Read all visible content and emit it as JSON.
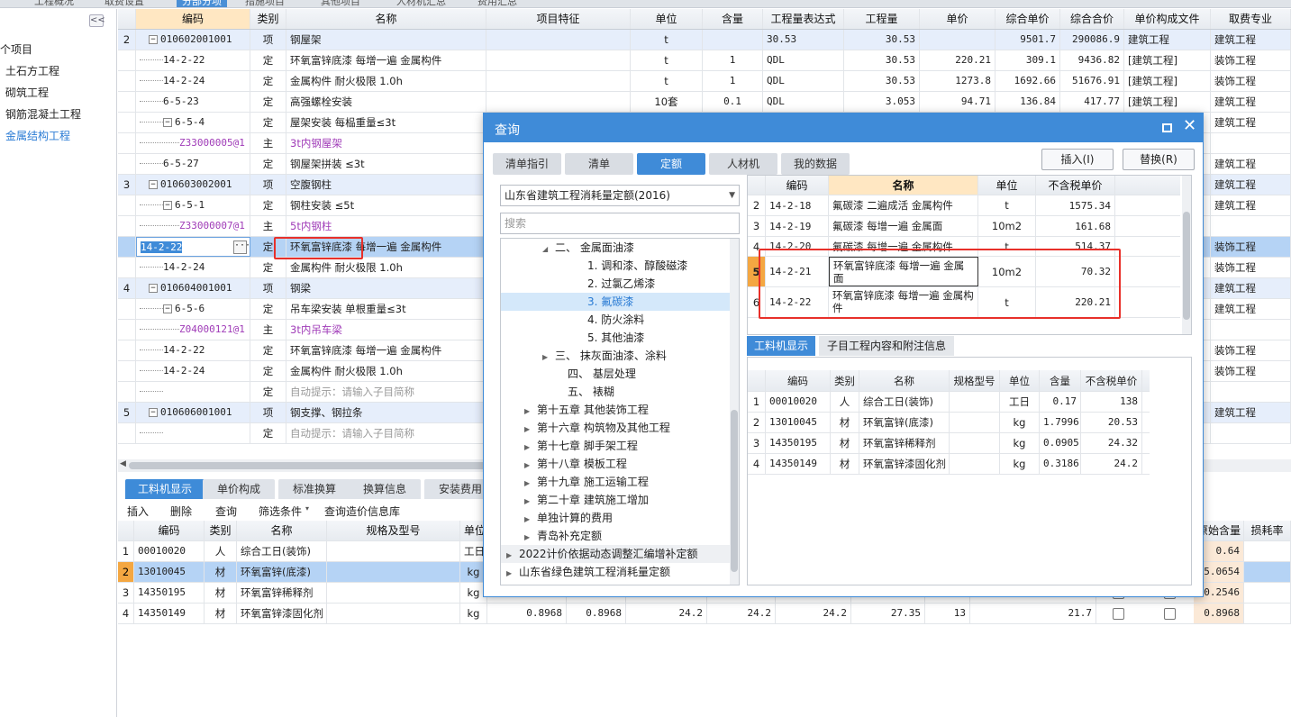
{
  "topbar": {
    "tabs": [
      "工程概况",
      "取费设置",
      "分部分项",
      "措施项目",
      "其他项目",
      "人材机汇总",
      "费用汇总"
    ]
  },
  "left": {
    "collapse": "<<",
    "items": [
      {
        "label": "个项目"
      },
      {
        "label": "土石方工程"
      },
      {
        "label": "砌筑工程"
      },
      {
        "label": "钢筋混凝土工程"
      },
      {
        "label": "金属结构工程",
        "selected": true
      }
    ]
  },
  "main": {
    "headers": [
      "编码",
      "类别",
      "名称",
      "项目特征",
      "单位",
      "含量",
      "工程量表达式",
      "工程量",
      "单价",
      "综合单价",
      "综合合价",
      "单价构成文件",
      "取费专业"
    ],
    "rows": [
      {
        "no": "2",
        "code": "010602001001",
        "type": "项",
        "name": "钢屋架",
        "unit": "t",
        "content": "",
        "expr": "30.53",
        "qty": "30.53",
        "price": "",
        "uprice": "9501.7",
        "total": "290086.9",
        "file": "建筑工程",
        "prof": "建筑工程",
        "kind": "xiang",
        "level": 0,
        "box": "−"
      },
      {
        "code": "14-2-22",
        "type": "定",
        "name": "环氧富锌底漆 每增一遍 金属构件",
        "unit": "t",
        "content": "1",
        "expr": "QDL",
        "qty": "30.53",
        "price": "220.21",
        "uprice": "309.1",
        "total": "9436.82",
        "file": "[建筑工程]",
        "prof": "装饰工程",
        "level": 1
      },
      {
        "code": "14-2-24",
        "type": "定",
        "name": "金属构件 耐火极限 1.0h",
        "unit": "t",
        "content": "1",
        "expr": "QDL",
        "qty": "30.53",
        "price": "1273.8",
        "uprice": "1692.66",
        "total": "51676.91",
        "file": "[建筑工程]",
        "prof": "装饰工程",
        "level": 1
      },
      {
        "code": "6-5-23",
        "type": "定",
        "name": "高强螺栓安装",
        "unit": "10套",
        "content": "0.1",
        "expr": "QDL",
        "qty": "3.053",
        "price": "94.71",
        "uprice": "136.84",
        "total": "417.77",
        "file": "[建筑工程]",
        "prof": "建筑工程",
        "level": 1
      },
      {
        "code": "6-5-4",
        "type": "定",
        "name": "屋架安装 每榀重量≤3t",
        "unit": "",
        "content": "",
        "expr": "",
        "qty": "",
        "price": "",
        "uprice": "",
        "total": "",
        "file": "",
        "prof": "建筑工程",
        "level": 1,
        "box": "−"
      },
      {
        "code": "Z33000005@1",
        "type": "主",
        "name": "3t内钢屋架",
        "unit": "",
        "content": "",
        "expr": "",
        "qty": "",
        "price": "",
        "uprice": "",
        "total": "",
        "file": "",
        "prof": "",
        "level": 2,
        "purple": true
      },
      {
        "code": "6-5-27",
        "type": "定",
        "name": "钢屋架拼装 ≤3t",
        "unit": "",
        "content": "",
        "expr": "",
        "qty": "",
        "price": "",
        "uprice": "",
        "total": "",
        "file": "",
        "prof": "建筑工程",
        "level": 1
      },
      {
        "no": "3",
        "code": "010603002001",
        "type": "项",
        "name": "空腹钢柱",
        "unit": "",
        "content": "",
        "expr": "",
        "qty": "",
        "price": "",
        "uprice": "",
        "total": "",
        "file": "",
        "prof": "建筑工程",
        "kind": "xiang",
        "level": 0,
        "box": "−"
      },
      {
        "code": "6-5-1",
        "type": "定",
        "name": "钢柱安装 ≤5t",
        "unit": "",
        "content": "",
        "expr": "",
        "qty": "",
        "price": "",
        "uprice": "",
        "total": "",
        "file": "",
        "prof": "建筑工程",
        "level": 1,
        "box": "−"
      },
      {
        "code": "Z33000007@1",
        "type": "主",
        "name": "5t内钢柱",
        "unit": "",
        "content": "",
        "expr": "",
        "qty": "",
        "price": "",
        "uprice": "",
        "total": "",
        "file": "",
        "prof": "",
        "level": 2,
        "purple": true
      },
      {
        "code": "14-2-22",
        "type": "定",
        "name": "环氧富锌底漆 每增一遍 金属构件",
        "unit": "",
        "content": "",
        "expr": "",
        "qty": "",
        "price": "",
        "uprice": "",
        "total": "",
        "file": "",
        "prof": "装饰工程",
        "kind": "sel",
        "editing": true
      },
      {
        "code": "14-2-24",
        "type": "定",
        "name": "金属构件 耐火极限 1.0h",
        "unit": "",
        "content": "",
        "expr": "",
        "qty": "",
        "price": "",
        "uprice": "",
        "total": "",
        "file": "",
        "prof": "装饰工程",
        "level": 1
      },
      {
        "no": "4",
        "code": "010604001001",
        "type": "项",
        "name": "钢梁",
        "unit": "",
        "content": "",
        "expr": "",
        "qty": "",
        "price": "",
        "uprice": "",
        "total": "",
        "file": "",
        "prof": "建筑工程",
        "kind": "xiang",
        "level": 0,
        "box": "−"
      },
      {
        "code": "6-5-6",
        "type": "定",
        "name": "吊车梁安装 单根重量≤3t",
        "unit": "",
        "content": "",
        "expr": "",
        "qty": "",
        "price": "",
        "uprice": "",
        "total": "",
        "file": "",
        "prof": "建筑工程",
        "level": 1,
        "box": "−"
      },
      {
        "code": "Z04000121@1",
        "type": "主",
        "name": "3t内吊车梁",
        "unit": "",
        "content": "",
        "expr": "",
        "qty": "",
        "price": "",
        "uprice": "",
        "total": "",
        "file": "",
        "prof": "",
        "level": 2,
        "purple": true
      },
      {
        "code": "14-2-22",
        "type": "定",
        "name": "环氧富锌底漆 每增一遍 金属构件",
        "unit": "",
        "content": "",
        "expr": "",
        "qty": "",
        "price": "",
        "uprice": "",
        "total": "",
        "file": "",
        "prof": "装饰工程",
        "level": 1
      },
      {
        "code": "14-2-24",
        "type": "定",
        "name": "金属构件 耐火极限 1.0h",
        "unit": "",
        "content": "",
        "expr": "",
        "qty": "",
        "price": "",
        "uprice": "",
        "total": "",
        "file": "",
        "prof": "装饰工程",
        "level": 1
      },
      {
        "code": "",
        "type": "定",
        "name": "自动提示：请输入子目简称",
        "unit": "",
        "content": "",
        "expr": "",
        "qty": "",
        "price": "",
        "uprice": "",
        "total": "",
        "file": "",
        "prof": "",
        "level": 1,
        "gray": true
      },
      {
        "no": "5",
        "code": "010606001001",
        "type": "项",
        "name": "钢支撑、钢拉条",
        "unit": "",
        "content": "",
        "expr": "",
        "qty": "",
        "price": "",
        "uprice": "",
        "total": "",
        "file": "",
        "prof": "建筑工程",
        "kind": "xiang",
        "level": 0,
        "box": "−"
      },
      {
        "code": "",
        "type": "定",
        "name": "自动提示：请输入子目简称",
        "unit": "",
        "content": "",
        "expr": "",
        "qty": "",
        "price": "",
        "uprice": "",
        "total": "",
        "file": "",
        "prof": "",
        "level": 1,
        "gray": true
      }
    ]
  },
  "bottom": {
    "tabs": [
      "工料机显示",
      "单价构成",
      "标准换算",
      "换算信息",
      "安装费用"
    ],
    "toolbar": [
      "插入",
      "删除",
      "查询",
      "筛选条件",
      "查询造价信息库"
    ],
    "headers": [
      "编码",
      "类别",
      "名称",
      "规格及型号",
      "单位",
      "原始含量",
      "损耗率"
    ],
    "rows": [
      {
        "no": "1",
        "code": "00010020",
        "type": "人",
        "name": "综合工日(装饰)",
        "unit": "工日",
        "orig": "0.64"
      },
      {
        "no": "2",
        "code": "13010045",
        "type": "材",
        "name": "环氧富锌(底漆)",
        "unit": "kg",
        "orig": "5.0654",
        "sel": true
      },
      {
        "no": "3",
        "code": "14350195",
        "type": "材",
        "name": "环氧富锌稀释剂",
        "unit": "kg",
        "orig": "0.2546"
      },
      {
        "no": "4",
        "code": "14350149",
        "type": "材",
        "name": "环氧富锌漆固化剂",
        "unit": "kg",
        "v1": "0.8968",
        "v2": "0.8968",
        "v3": "24.2",
        "v4": "24.2",
        "v5": "24.2",
        "v6": "27.35",
        "v7": "13",
        "v8": "21.7",
        "orig": "0.8968"
      }
    ]
  },
  "dialog": {
    "title": "查询",
    "tabs": [
      "清单指引",
      "清单",
      "定额",
      "人材机",
      "我的数据"
    ],
    "insert": "插入(I)",
    "replace": "替换(R)",
    "library": "山东省建筑工程消耗量定额(2016)",
    "search_placeholder": "搜索",
    "tree": [
      {
        "label": "二、 金属面油漆",
        "indent": 46,
        "arrow": "◢"
      },
      {
        "label": "1. 调和漆、醇酸磁漆",
        "indent": 82
      },
      {
        "label": "2. 过氯乙烯漆",
        "indent": 82
      },
      {
        "label": "3. 氟碳漆",
        "indent": 82,
        "sel": true
      },
      {
        "label": "4. 防火涂料",
        "indent": 82
      },
      {
        "label": "5. 其他油漆",
        "indent": 82
      },
      {
        "label": "三、 抹灰面油漆、涂料",
        "indent": 46,
        "arrow": "▶"
      },
      {
        "label": "四、 基层处理",
        "indent": 60
      },
      {
        "label": "五、 裱糊",
        "indent": 60
      },
      {
        "label": "第十五章 其他装饰工程",
        "indent": 26,
        "arrow": "▶"
      },
      {
        "label": "第十六章 构筑物及其他工程",
        "indent": 26,
        "arrow": "▶"
      },
      {
        "label": "第十七章 脚手架工程",
        "indent": 26,
        "arrow": "▶"
      },
      {
        "label": "第十八章 模板工程",
        "indent": 26,
        "arrow": "▶"
      },
      {
        "label": "第十九章 施工运输工程",
        "indent": 26,
        "arrow": "▶"
      },
      {
        "label": "第二十章 建筑施工增加",
        "indent": 26,
        "arrow": "▶"
      },
      {
        "label": "单独计算的费用",
        "indent": 26,
        "arrow": "▶"
      },
      {
        "label": "青岛补充定额",
        "indent": 26,
        "arrow": "▶"
      },
      {
        "label": "2022计价依据动态调整汇编增补定额",
        "indent": 6,
        "arrow": "▶",
        "hl": true
      },
      {
        "label": "山东省绿色建筑工程消耗量定额",
        "indent": 6,
        "arrow": "▶"
      }
    ],
    "quota_headers": [
      "编码",
      "名称",
      "单位",
      "不含税单价"
    ],
    "quota_rows": [
      {
        "no": "2",
        "code": "14-2-18",
        "name": "氟碳漆 二遍成活 金属构件",
        "unit": "t",
        "price": "1575.34"
      },
      {
        "no": "3",
        "code": "14-2-19",
        "name": "氟碳漆 每增一遍 金属面",
        "unit": "10m2",
        "price": "161.68"
      },
      {
        "no": "4",
        "code": "14-2-20",
        "name": "氟碳漆 每增一遍 金属构件",
        "unit": "t",
        "price": "514.37"
      },
      {
        "no": "5",
        "code": "14-2-21",
        "name": "环氧富锌底漆 每增一遍 金属面",
        "unit": "10m2",
        "price": "70.32",
        "sel": true
      },
      {
        "no": "6",
        "code": "14-2-22",
        "name": "环氧富锌底漆 每增一遍 金属构件",
        "unit": "t",
        "price": "220.21"
      }
    ],
    "sub_tabs": [
      "工料机显示",
      "子目工程内容和附注信息"
    ],
    "res_headers": [
      "编码",
      "类别",
      "名称",
      "规格型号",
      "单位",
      "含量",
      "不含税单价"
    ],
    "res_rows": [
      {
        "no": "1",
        "code": "00010020",
        "type": "人",
        "name": "综合工日(装饰)",
        "unit": "工日",
        "qty": "0.17",
        "price": "138"
      },
      {
        "no": "2",
        "code": "13010045",
        "type": "材",
        "name": "环氧富锌(底漆)",
        "unit": "kg",
        "qty": "1.7996",
        "price": "20.53"
      },
      {
        "no": "3",
        "code": "14350195",
        "type": "材",
        "name": "环氧富锌稀释剂",
        "unit": "kg",
        "qty": "0.0905",
        "price": "24.32"
      },
      {
        "no": "4",
        "code": "14350149",
        "type": "材",
        "name": "环氧富锌漆固化剂",
        "unit": "kg",
        "qty": "0.3186",
        "price": "24.2"
      }
    ]
  }
}
